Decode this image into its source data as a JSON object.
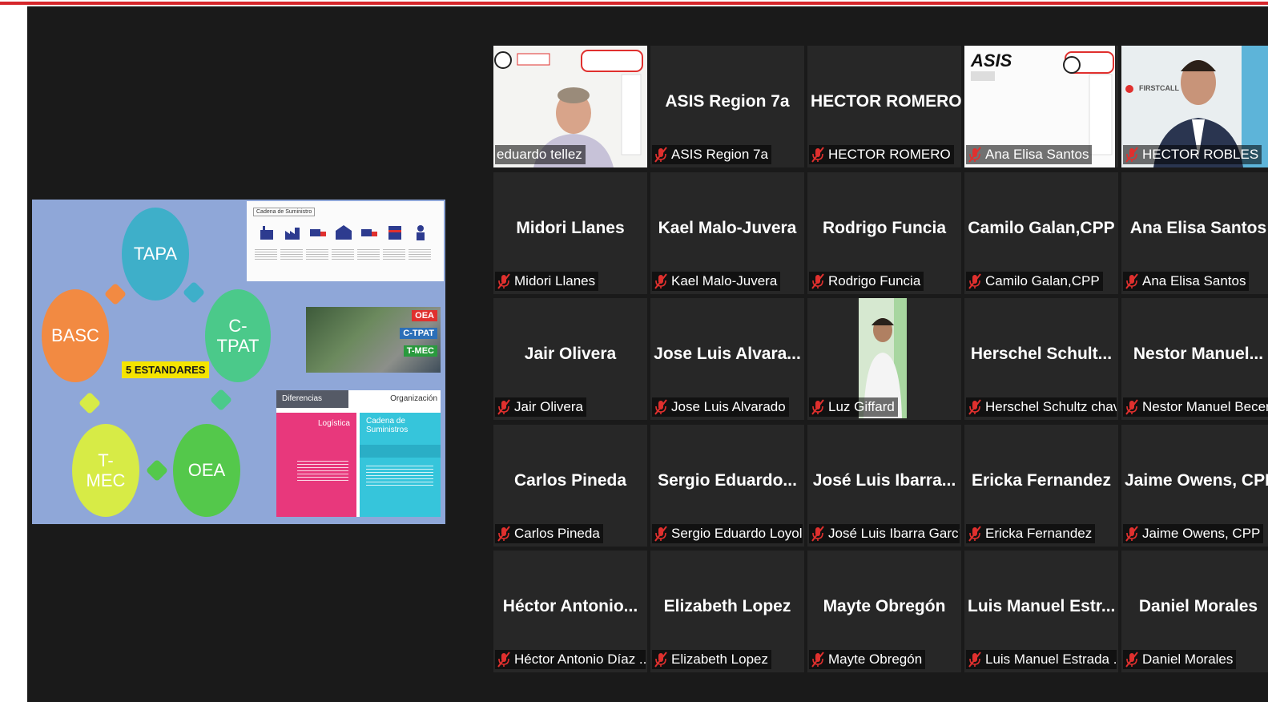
{
  "slide": {
    "circles": [
      "TAPA",
      "C-\nTPAT",
      "OEA",
      "T-\nMEC",
      "BASC"
    ],
    "center_label": "5 ESTANDARES",
    "supply_chain_title": "Cadena de Suministro",
    "map_tags": [
      "OEA",
      "C-TPAT",
      "T-MEC"
    ],
    "diff_header_left": "Diferencias",
    "diff_header_right": "Organización",
    "diff_left_title": "Logística",
    "diff_right_title": "Cadena de\nSuministros"
  },
  "participants": [
    {
      "title": "",
      "label": "eduardo tellez",
      "muted": false,
      "video": "speaker"
    },
    {
      "title": "ASIS Region 7a",
      "label": "ASIS Region 7a",
      "muted": true
    },
    {
      "title": "HECTOR ROMERO",
      "label": "HECTOR ROMERO",
      "muted": true
    },
    {
      "title": "",
      "label": "Ana Elisa Santos",
      "muted": true,
      "video": "logo",
      "logo_text": "ASIS"
    },
    {
      "title": "",
      "label": "HECTOR ROBLES",
      "muted": true,
      "video": "person",
      "logo_text": "FIRSTCALL"
    },
    {
      "title": "Midori Llanes",
      "label": "Midori Llanes",
      "muted": true
    },
    {
      "title": "Kael Malo-Juvera",
      "label": "Kael Malo-Juvera",
      "muted": true
    },
    {
      "title": "Rodrigo Funcia",
      "label": "Rodrigo Funcia",
      "muted": true
    },
    {
      "title": "Camilo Galan,CPP",
      "label": "Camilo Galan,CPP",
      "muted": true
    },
    {
      "title": "Ana Elisa Santos",
      "label": "Ana Elisa Santos",
      "muted": true
    },
    {
      "title": "Jair Olivera",
      "label": "Jair Olivera",
      "muted": true
    },
    {
      "title": "Jose Luis Alvara...",
      "label": "Jose Luis Alvarado",
      "muted": true
    },
    {
      "title": "",
      "label": "Luz Giffard",
      "muted": true,
      "video": "small"
    },
    {
      "title": "Herschel  Schult...",
      "label": "Herschel Schultz chav...",
      "muted": true
    },
    {
      "title": "Nestor  Manuel...",
      "label": "Nestor Manuel Becer",
      "muted": true
    },
    {
      "title": "Carlos Pineda",
      "label": "Carlos Pineda",
      "muted": true
    },
    {
      "title": "Sergio  Eduardo...",
      "label": "Sergio Eduardo Loyola",
      "muted": true
    },
    {
      "title": "José Luis Ibarra...",
      "label": "José Luis Ibarra García",
      "muted": true
    },
    {
      "title": "Ericka Fernandez",
      "label": "Ericka Fernandez",
      "muted": true
    },
    {
      "title": "Jaime Owens, CPP",
      "label": "Jaime Owens, CPP",
      "muted": true
    },
    {
      "title": "Héctor  Antonio...",
      "label": "Héctor Antonio Díaz ...",
      "muted": true
    },
    {
      "title": "Elizabeth Lopez",
      "label": "Elizabeth Lopez",
      "muted": true
    },
    {
      "title": "Mayte Obregón",
      "label": "Mayte Obregón",
      "muted": true
    },
    {
      "title": "Luis Manuel  Estr...",
      "label": "Luis Manuel Estrada ...",
      "muted": true
    },
    {
      "title": "Daniel Morales",
      "label": "Daniel Morales",
      "muted": true
    }
  ],
  "colors": {
    "accent_red": "#d6262b",
    "active_speaker": "#cfe63a",
    "mic_muted": "#e0302e"
  }
}
